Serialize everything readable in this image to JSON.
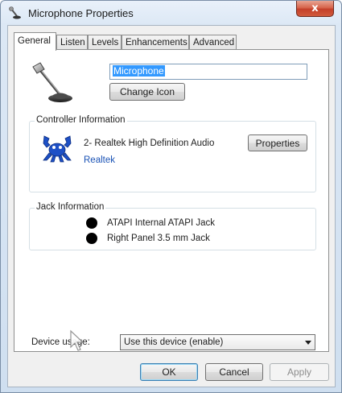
{
  "window": {
    "title": "Microphone Properties",
    "close_glyph": "x"
  },
  "tabs": [
    {
      "label": "General",
      "active": true
    },
    {
      "label": "Listen"
    },
    {
      "label": "Levels"
    },
    {
      "label": "Enhancements"
    },
    {
      "label": "Advanced"
    }
  ],
  "general": {
    "device_name": "Microphone",
    "change_icon_label": "Change Icon",
    "controller": {
      "title": "Controller Information",
      "name": "2- Realtek High Definition Audio",
      "vendor": "Realtek",
      "properties_label": "Properties"
    },
    "jack": {
      "title": "Jack Information",
      "items": [
        "ATAPI Internal ATAPI Jack",
        "Right Panel 3.5 mm Jack"
      ]
    },
    "device_usage": {
      "label": "Device usage:",
      "selected": "Use this device (enable)"
    }
  },
  "footer": {
    "ok": "OK",
    "cancel": "Cancel",
    "apply": "Apply",
    "apply_enabled": false
  },
  "icons": {
    "title": "microphone-icon",
    "device": "microphone-stand-icon",
    "controller": "realtek-crab-icon",
    "jack": "jack-dot-icon",
    "cursor": "mouse-cursor-icon"
  },
  "colors": {
    "link": "#1a52b5",
    "selection": "#3399ff",
    "close_button": "#c4402a"
  }
}
